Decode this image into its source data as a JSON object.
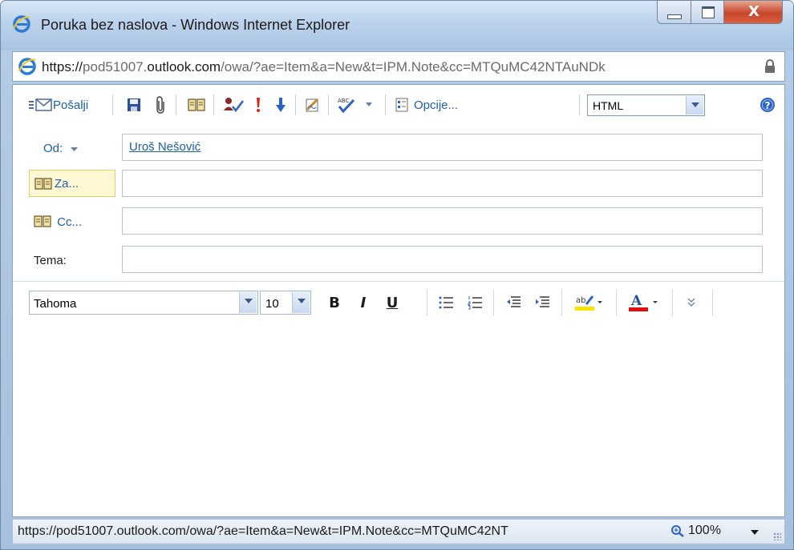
{
  "window": {
    "title": "Poruka bez naslova - Windows Internet Explorer",
    "close_label": "X"
  },
  "address": {
    "scheme": "https://",
    "sub": "pod51007.",
    "domain": "outlook.com",
    "path": "/owa/?ae=Item&a=New&t=IPM.Note&cc=MTQuMC42NTAuNDk"
  },
  "toolbar": {
    "send_label": "Pošalji",
    "options_label": "Opcije...",
    "format_value": "HTML"
  },
  "header_fields": {
    "from_label": "Od:",
    "from_value": "Uroš Nešović",
    "to_label": "Za...",
    "cc_label": "Cc...",
    "subject_label": "Tema:"
  },
  "format_bar": {
    "font_value": "Tahoma",
    "size_value": "10",
    "bold": "B",
    "italic": "I",
    "underline": "U",
    "font_color_letter": "A"
  },
  "status": {
    "url": "https://pod51007.outlook.com/owa/?ae=Item&a=New&t=IPM.Note&cc=MTQuMC42NT",
    "zoom": "100%"
  },
  "colors": {
    "accent": "#1e5fa8",
    "highlight": "#f5e600",
    "font_color": "#e01010"
  }
}
